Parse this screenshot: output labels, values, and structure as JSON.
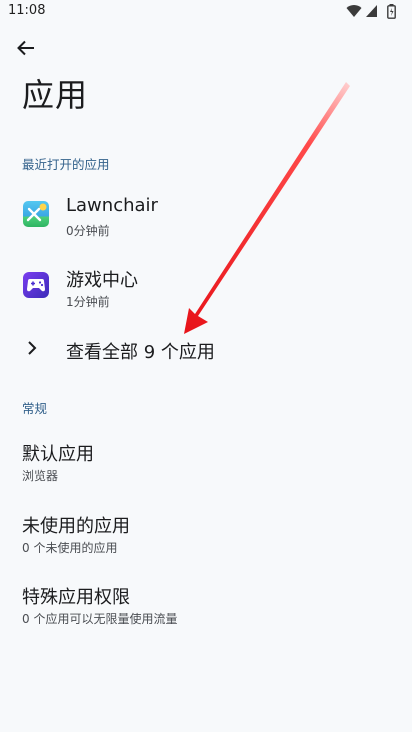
{
  "status": {
    "time": "11:08"
  },
  "page": {
    "title": "应用"
  },
  "recent": {
    "header": "最近打开的应用",
    "apps": [
      {
        "name": "Lawnchair",
        "time": "0分钟前",
        "icon": "lawnchair-icon"
      },
      {
        "name": "游戏中心",
        "time": "1分钟前",
        "icon": "game-center-icon"
      }
    ],
    "see_all": "查看全部 9 个应用"
  },
  "general": {
    "header": "常规",
    "items": [
      {
        "title": "默认应用",
        "subtitle": "浏览器"
      },
      {
        "title": "未使用的应用",
        "subtitle": "0 个未使用的应用"
      },
      {
        "title": "特殊应用权限",
        "subtitle": "0 个应用可以无限量使用流量"
      }
    ]
  },
  "colors": {
    "accent": "#34628c",
    "background": "#f7f9fb",
    "annotation_arrow": "#e8141a"
  }
}
